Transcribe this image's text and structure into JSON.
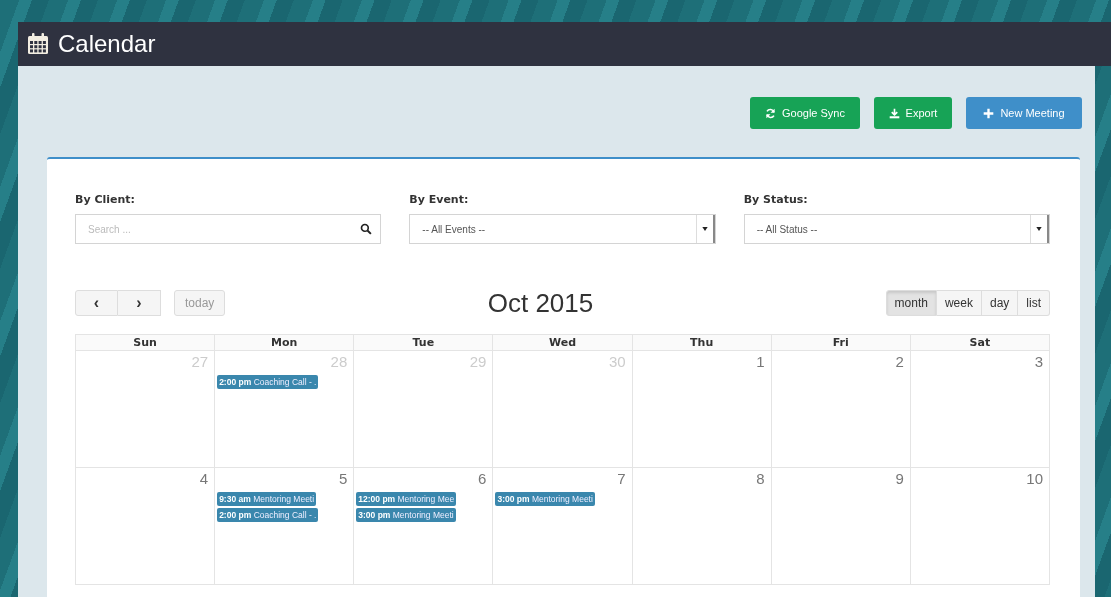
{
  "header": {
    "title": "Calendar"
  },
  "actions": [
    {
      "kind": "sync",
      "label": "Google Sync"
    },
    {
      "kind": "export",
      "label": "Export"
    },
    {
      "kind": "new",
      "label": "New Meeting"
    }
  ],
  "filters": [
    {
      "kind": "search",
      "label": "By Client:",
      "placeholder": "Search ..."
    },
    {
      "kind": "select",
      "label": "By Event:",
      "value": "-- All Events --"
    },
    {
      "kind": "select",
      "label": "By Status:",
      "value": "-- All Status --"
    }
  ],
  "toolbar": {
    "prev": "‹",
    "next": "›",
    "today": "today",
    "title": "Oct 2015",
    "views": [
      {
        "label": "month",
        "selected": true
      },
      {
        "label": "week",
        "selected": false
      },
      {
        "label": "day",
        "selected": false
      },
      {
        "label": "list",
        "selected": false
      }
    ]
  },
  "weekdays": [
    "Sun",
    "Mon",
    "Tue",
    "Wed",
    "Thu",
    "Fri",
    "Sat"
  ],
  "weeks": [
    {
      "days": [
        {
          "date": "27",
          "muted": true
        },
        {
          "date": "28",
          "muted": true,
          "events": [
            {
              "time": "2:00 pm",
              "title": "Coaching Call - ."
            }
          ]
        },
        {
          "date": "29",
          "muted": true
        },
        {
          "date": "30",
          "muted": true
        },
        {
          "date": "1",
          "muted": false
        },
        {
          "date": "2",
          "muted": false
        },
        {
          "date": "3",
          "muted": false
        }
      ]
    },
    {
      "days": [
        {
          "date": "4",
          "muted": false
        },
        {
          "date": "5",
          "muted": false,
          "events": [
            {
              "time": "9:30 am",
              "title": "Mentoring Meeti"
            },
            {
              "time": "2:00 pm",
              "title": "Coaching Call - ."
            }
          ]
        },
        {
          "date": "6",
          "muted": false,
          "events": [
            {
              "time": "12:00 pm",
              "title": "Mentoring Mee"
            },
            {
              "time": "3:00 pm",
              "title": "Mentoring Meeti"
            }
          ]
        },
        {
          "date": "7",
          "muted": false,
          "events": [
            {
              "time": "3:00 pm",
              "title": "Mentoring Meeti"
            }
          ]
        },
        {
          "date": "8",
          "muted": false
        },
        {
          "date": "9",
          "muted": false
        },
        {
          "date": "10",
          "muted": false
        }
      ]
    }
  ]
}
